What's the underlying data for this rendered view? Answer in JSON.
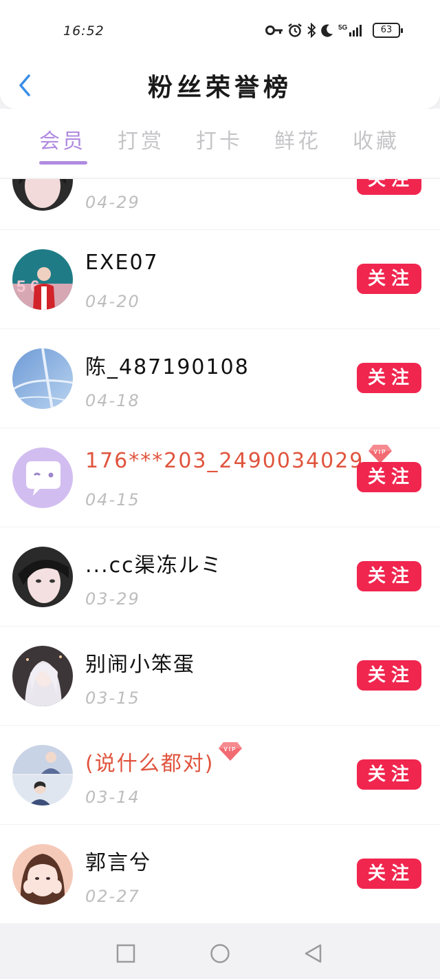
{
  "status_bar": {
    "time": "16:52",
    "battery": "63",
    "network": "5G"
  },
  "header": {
    "title": "粉丝荣誉榜"
  },
  "tabs": [
    {
      "label": "会员",
      "active": true
    },
    {
      "label": "打赏",
      "active": false
    },
    {
      "label": "打卡",
      "active": false
    },
    {
      "label": "鲜花",
      "active": false
    },
    {
      "label": "收藏",
      "active": false
    }
  ],
  "fans": [
    {
      "name": "",
      "date": "04-29",
      "vip": false,
      "follow_label": "关注",
      "avatar": "photo-girl-face"
    },
    {
      "name": "EXE07",
      "date": "04-20",
      "vip": false,
      "follow_label": "关注",
      "avatar": "photo-man-red-jacket"
    },
    {
      "name": "陈_487190108",
      "date": "04-18",
      "vip": false,
      "follow_label": "关注",
      "avatar": "photo-blue-sky"
    },
    {
      "name": "176***203_2490034029",
      "date": "04-15",
      "vip": true,
      "follow_label": "关注",
      "avatar": "default-chat-bubble"
    },
    {
      "name": "...cc渠冻ルミ",
      "date": "03-29",
      "vip": false,
      "follow_label": "关注",
      "avatar": "photo-girl-face"
    },
    {
      "name": "别闹小笨蛋",
      "date": "03-15",
      "vip": false,
      "follow_label": "关注",
      "avatar": "photo-anime-white-hair"
    },
    {
      "name": "(说什么都对)",
      "date": "03-14",
      "vip": true,
      "follow_label": "关注",
      "avatar": "photo-couple"
    },
    {
      "name": "郭言兮",
      "date": "02-27",
      "vip": false,
      "follow_label": "关注",
      "avatar": "photo-girl-pink"
    }
  ],
  "colors": {
    "accent": "#b08be0",
    "follow": "#f0264f",
    "vip_name": "#e0543d"
  }
}
